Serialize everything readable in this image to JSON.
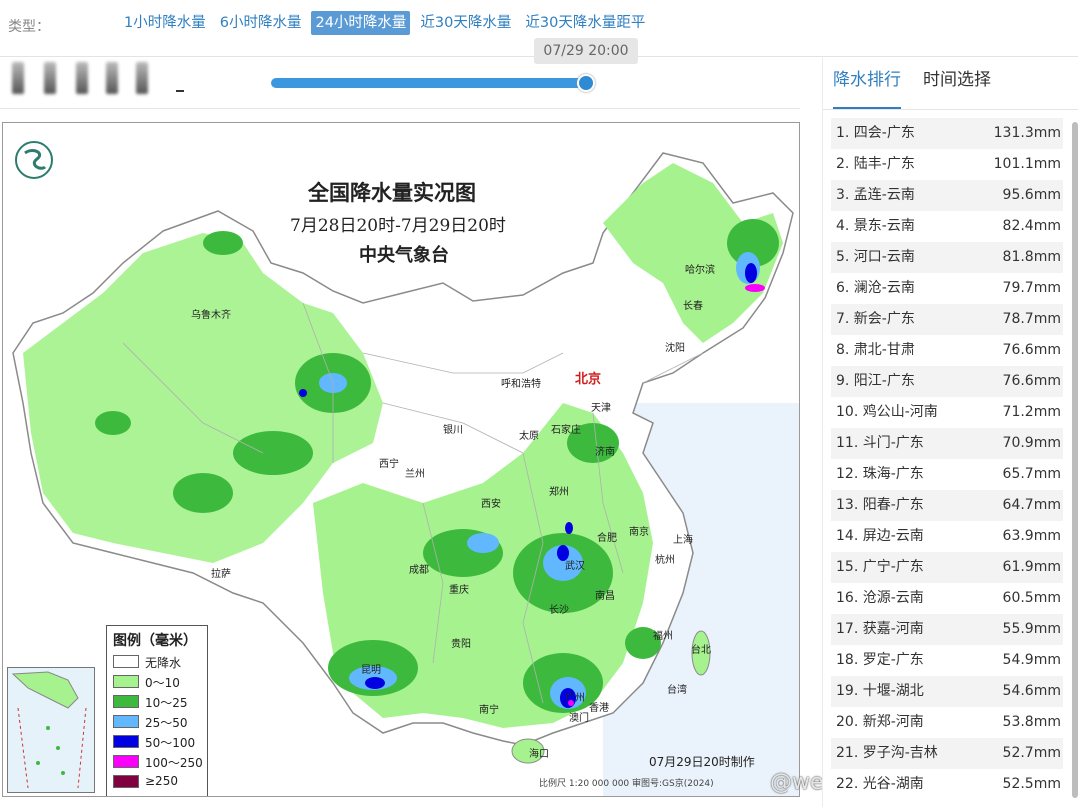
{
  "type_bar": {
    "label": "类型：",
    "tabs": [
      {
        "label": "1小时降水量"
      },
      {
        "label": "6小时降水量"
      },
      {
        "label": "24小时降水量"
      },
      {
        "label": "近30天降水量"
      },
      {
        "label": "近30天降水量距平"
      }
    ],
    "active_index": 2
  },
  "time_slider": {
    "tooltip": "07/29 20:00",
    "progress": 1.0
  },
  "map": {
    "title": "全国降水量实况图",
    "subtitle": "7月28日20时-7月29日20时",
    "agency": "中央气象台",
    "made_time": "07月29日20时制作",
    "scale_note": "比例尺 1:20 000 000    审图号:GS京(2024)",
    "cities": [
      {
        "name": "哈尔滨"
      },
      {
        "name": "长春"
      },
      {
        "name": "乌鲁木齐"
      },
      {
        "name": "沈阳"
      },
      {
        "name": "呼和浩特"
      },
      {
        "name": "北京"
      },
      {
        "name": "天津"
      },
      {
        "name": "银川"
      },
      {
        "name": "太原"
      },
      {
        "name": "石家庄"
      },
      {
        "name": "西宁"
      },
      {
        "name": "兰州"
      },
      {
        "name": "济南"
      },
      {
        "name": "西安"
      },
      {
        "name": "郑州"
      },
      {
        "name": "南京"
      },
      {
        "name": "合肥"
      },
      {
        "name": "上海"
      },
      {
        "name": "成都"
      },
      {
        "name": "武汉"
      },
      {
        "name": "杭州"
      },
      {
        "name": "拉萨"
      },
      {
        "name": "重庆"
      },
      {
        "name": "长沙"
      },
      {
        "name": "南昌"
      },
      {
        "name": "贵阳"
      },
      {
        "name": "福州"
      },
      {
        "name": "台北"
      },
      {
        "name": "昆明"
      },
      {
        "name": "广州"
      },
      {
        "name": "南宁"
      },
      {
        "name": "香港"
      },
      {
        "name": "澳门"
      },
      {
        "name": "海口"
      },
      {
        "name": "台湾"
      }
    ],
    "legend": {
      "title": "图例（毫米）",
      "items": [
        {
          "label": "无降水",
          "color": "#ffffff"
        },
        {
          "label": "0～10",
          "color": "#a6f28f"
        },
        {
          "label": "10～25",
          "color": "#3dba3d"
        },
        {
          "label": "25～50",
          "color": "#61b8ff"
        },
        {
          "label": "50～100",
          "color": "#0000e1"
        },
        {
          "label": "100～250",
          "color": "#fa00fa"
        },
        {
          "label": "≥250",
          "color": "#800040"
        }
      ]
    },
    "watermark": "@weatherman_信欣"
  },
  "ranking": {
    "tabs": [
      {
        "label": "降水排行"
      },
      {
        "label": "时间选择"
      }
    ],
    "active_index": 0,
    "rows": [
      {
        "name": "1. 四会-广东",
        "value": "131.3mm"
      },
      {
        "name": "2. 陆丰-广东",
        "value": "101.1mm"
      },
      {
        "name": "3. 孟连-云南",
        "value": "95.6mm"
      },
      {
        "name": "4. 景东-云南",
        "value": "82.4mm"
      },
      {
        "name": "5. 河口-云南",
        "value": "81.8mm"
      },
      {
        "name": "6. 澜沧-云南",
        "value": "79.7mm"
      },
      {
        "name": "7. 新会-广东",
        "value": "78.7mm"
      },
      {
        "name": "8. 肃北-甘肃",
        "value": "76.6mm"
      },
      {
        "name": "9. 阳江-广东",
        "value": "76.6mm"
      },
      {
        "name": "10. 鸡公山-河南",
        "value": "71.2mm"
      },
      {
        "name": "11. 斗门-广东",
        "value": "70.9mm"
      },
      {
        "name": "12. 珠海-广东",
        "value": "65.7mm"
      },
      {
        "name": "13. 阳春-广东",
        "value": "64.7mm"
      },
      {
        "name": "14. 屏边-云南",
        "value": "63.9mm"
      },
      {
        "name": "15. 广宁-广东",
        "value": "61.9mm"
      },
      {
        "name": "16. 沧源-云南",
        "value": "60.5mm"
      },
      {
        "name": "17. 获嘉-河南",
        "value": "55.9mm"
      },
      {
        "name": "18. 罗定-广东",
        "value": "54.9mm"
      },
      {
        "name": "19. 十堰-湖北",
        "value": "54.6mm"
      },
      {
        "name": "20. 新郑-河南",
        "value": "53.8mm"
      },
      {
        "name": "21. 罗子沟-吉林",
        "value": "52.7mm"
      },
      {
        "name": "22. 光谷-湖南",
        "value": "52.5mm"
      }
    ]
  }
}
